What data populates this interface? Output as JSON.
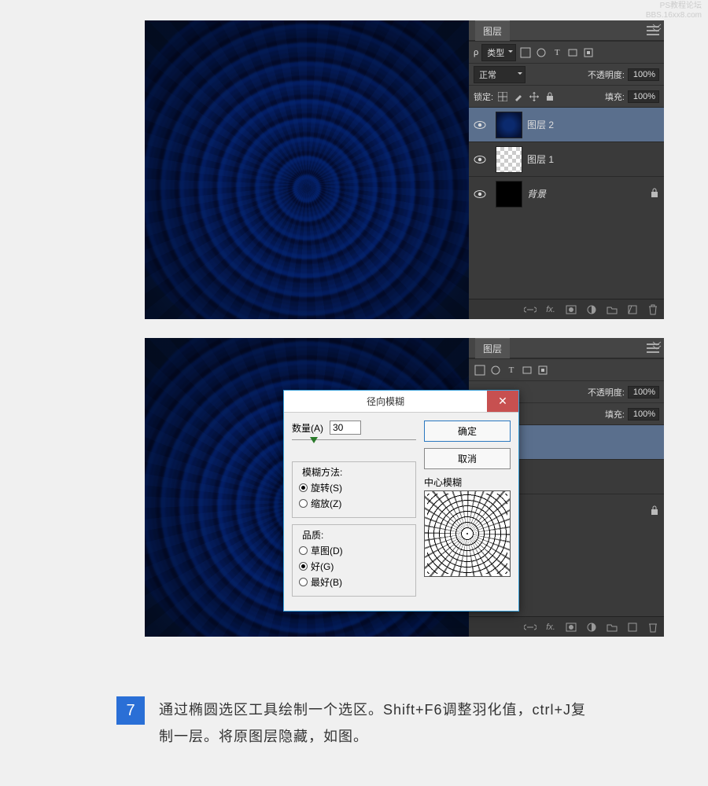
{
  "watermark": {
    "line1": "PS教程论坛",
    "line2": "BBS.16xx8.com"
  },
  "panel": {
    "title": "图层",
    "search_prefix": "ρ",
    "kind_label": "类型",
    "blend_label": "正常",
    "opacity_label": "不透明度:",
    "opacity_value": "100%",
    "lock_prefix": "锁定:",
    "fill_label": "填充:",
    "fill_value": "100%",
    "layers": [
      {
        "name": "图层 2",
        "thumb": "swirl",
        "selected": true
      },
      {
        "name": "图层 1",
        "thumb": "checker",
        "selected": false
      },
      {
        "name": "背景",
        "thumb": "black",
        "selected": false,
        "locked": true,
        "italic": true
      }
    ],
    "footer_text": "fx."
  },
  "dialog": {
    "title": "径向模糊",
    "amount_label": "数量(A)",
    "amount_value": "30",
    "ok": "确定",
    "cancel": "取消",
    "method_legend": "模糊方法:",
    "method_spin": "旋转(S)",
    "method_zoom": "缩放(Z)",
    "quality_legend": "品质:",
    "quality_draft": "草图(D)",
    "quality_good": "好(G)",
    "quality_best": "最好(B)",
    "preview_label": "中心模糊"
  },
  "step7": {
    "num": "7",
    "text": "通过椭圆选区工具绘制一个选区。Shift+F6调整羽化值，ctrl+J复制一层。将原图层隐藏，如图。"
  }
}
